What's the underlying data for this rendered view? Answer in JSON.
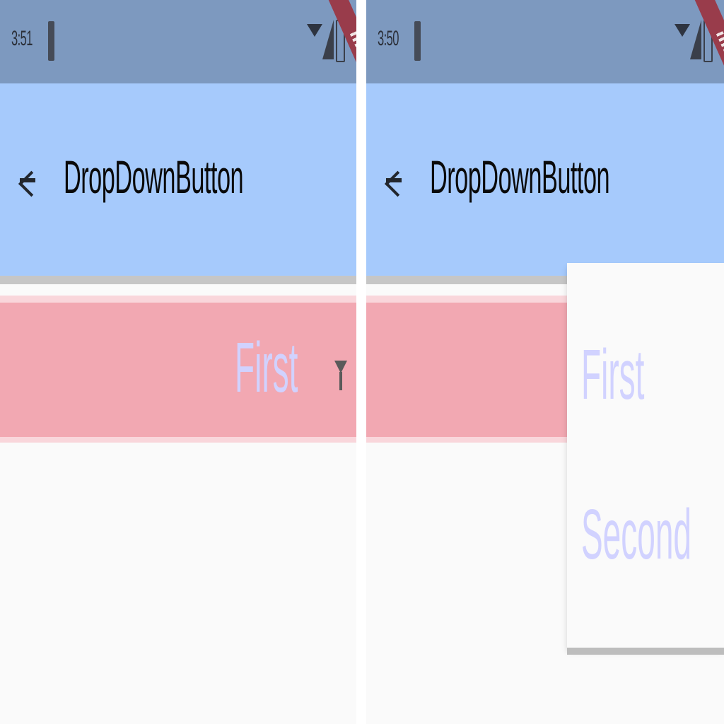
{
  "screens": [
    {
      "status_bar": {
        "time": "3:51"
      },
      "app_bar": {
        "title": "DropDownButton"
      },
      "dropdown": {
        "selected_value": "First"
      }
    },
    {
      "status_bar": {
        "time": "3:50"
      },
      "app_bar": {
        "title": "DropDownButton"
      },
      "dropdown_menu": {
        "items": [
          "First",
          "Second"
        ]
      }
    }
  ],
  "colors": {
    "status_bar": "#7d99bf",
    "app_bar": "#a6cafc",
    "dropdown_row": "#f2a8b2",
    "dropdown_text": "#d1d2ff",
    "debug_ribbon": "#993c4b"
  }
}
